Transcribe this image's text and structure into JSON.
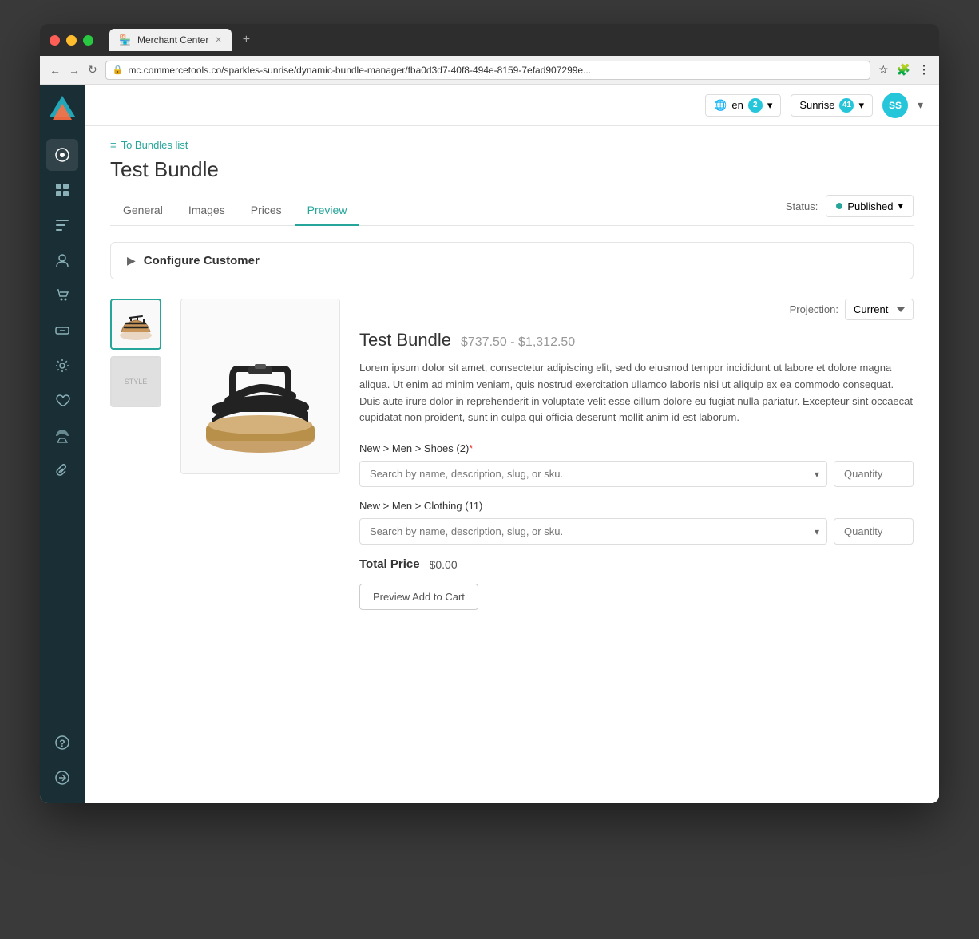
{
  "browser": {
    "tab_title": "Merchant Center",
    "url": "mc.commercetools.co/sparkles-sunrise/dynamic-bundle-manager/fba0d3d7-40f8-494e-8159-7efad907299e...",
    "favicon": "🏪"
  },
  "topbar": {
    "lang": "en",
    "lang_badge": "2",
    "project": "Sunrise",
    "project_badge": "41",
    "user_initials": "SS"
  },
  "breadcrumb": {
    "back_label": "To Bundles list"
  },
  "page": {
    "title": "Test Bundle",
    "tabs": [
      {
        "label": "General",
        "active": false
      },
      {
        "label": "Images",
        "active": false
      },
      {
        "label": "Prices",
        "active": false
      },
      {
        "label": "Preview",
        "active": true
      }
    ],
    "status_label": "Status:",
    "status_value": "Published"
  },
  "configure": {
    "label": "Configure Customer"
  },
  "bundle": {
    "name": "Test Bundle",
    "price_range": "$737.50 - $1,312.50",
    "description": "Lorem ipsum dolor sit amet, consectetur adipiscing elit, sed do eiusmod tempor incididunt ut labore et dolore magna aliqua. Ut enim ad minim veniam, quis nostrud exercitation ullamco laboris nisi ut aliquip ex ea commodo consequat. Duis aute irure dolor in reprehenderit in voluptate velit esse cillum dolore eu fugiat nulla pariatur. Excepteur sint occaecat cupidatat non proident, sunt in culpa qui officia deserunt mollit anim id est laborum.",
    "projection_label": "Projection:",
    "projection_value": "Current",
    "categories": [
      {
        "label": "New > Men > Shoes (2)",
        "required": true,
        "placeholder": "Search by name, description, slug, or sku.",
        "quantity_placeholder": "Quantity"
      },
      {
        "label": "New > Men > Clothing (11)",
        "required": false,
        "placeholder": "Search by name, description, slug, or sku.",
        "quantity_placeholder": "Quantity"
      }
    ],
    "total_label": "Total Price",
    "total_value": "$0.00",
    "preview_button": "Preview Add to Cart"
  },
  "sidebar": {
    "items": [
      {
        "icon": "●",
        "name": "dashboard",
        "label": "Dashboard"
      },
      {
        "icon": "◼",
        "name": "products",
        "label": "Products"
      },
      {
        "icon": "⊞",
        "name": "categories",
        "label": "Categories"
      },
      {
        "icon": "👤",
        "name": "customers",
        "label": "Customers"
      },
      {
        "icon": "🛒",
        "name": "orders",
        "label": "Orders"
      },
      {
        "icon": "🏷",
        "name": "discounts",
        "label": "Discounts"
      },
      {
        "icon": "⚙",
        "name": "settings",
        "label": "Settings"
      },
      {
        "icon": "♥",
        "name": "wishlist",
        "label": "Wishlist"
      },
      {
        "icon": "🚀",
        "name": "launch",
        "label": "Launch"
      },
      {
        "icon": "📎",
        "name": "attachments",
        "label": "Attachments"
      }
    ],
    "bottom_items": [
      {
        "icon": "?",
        "name": "help",
        "label": "Help"
      },
      {
        "icon": "→",
        "name": "navigate",
        "label": "Navigate"
      }
    ]
  }
}
